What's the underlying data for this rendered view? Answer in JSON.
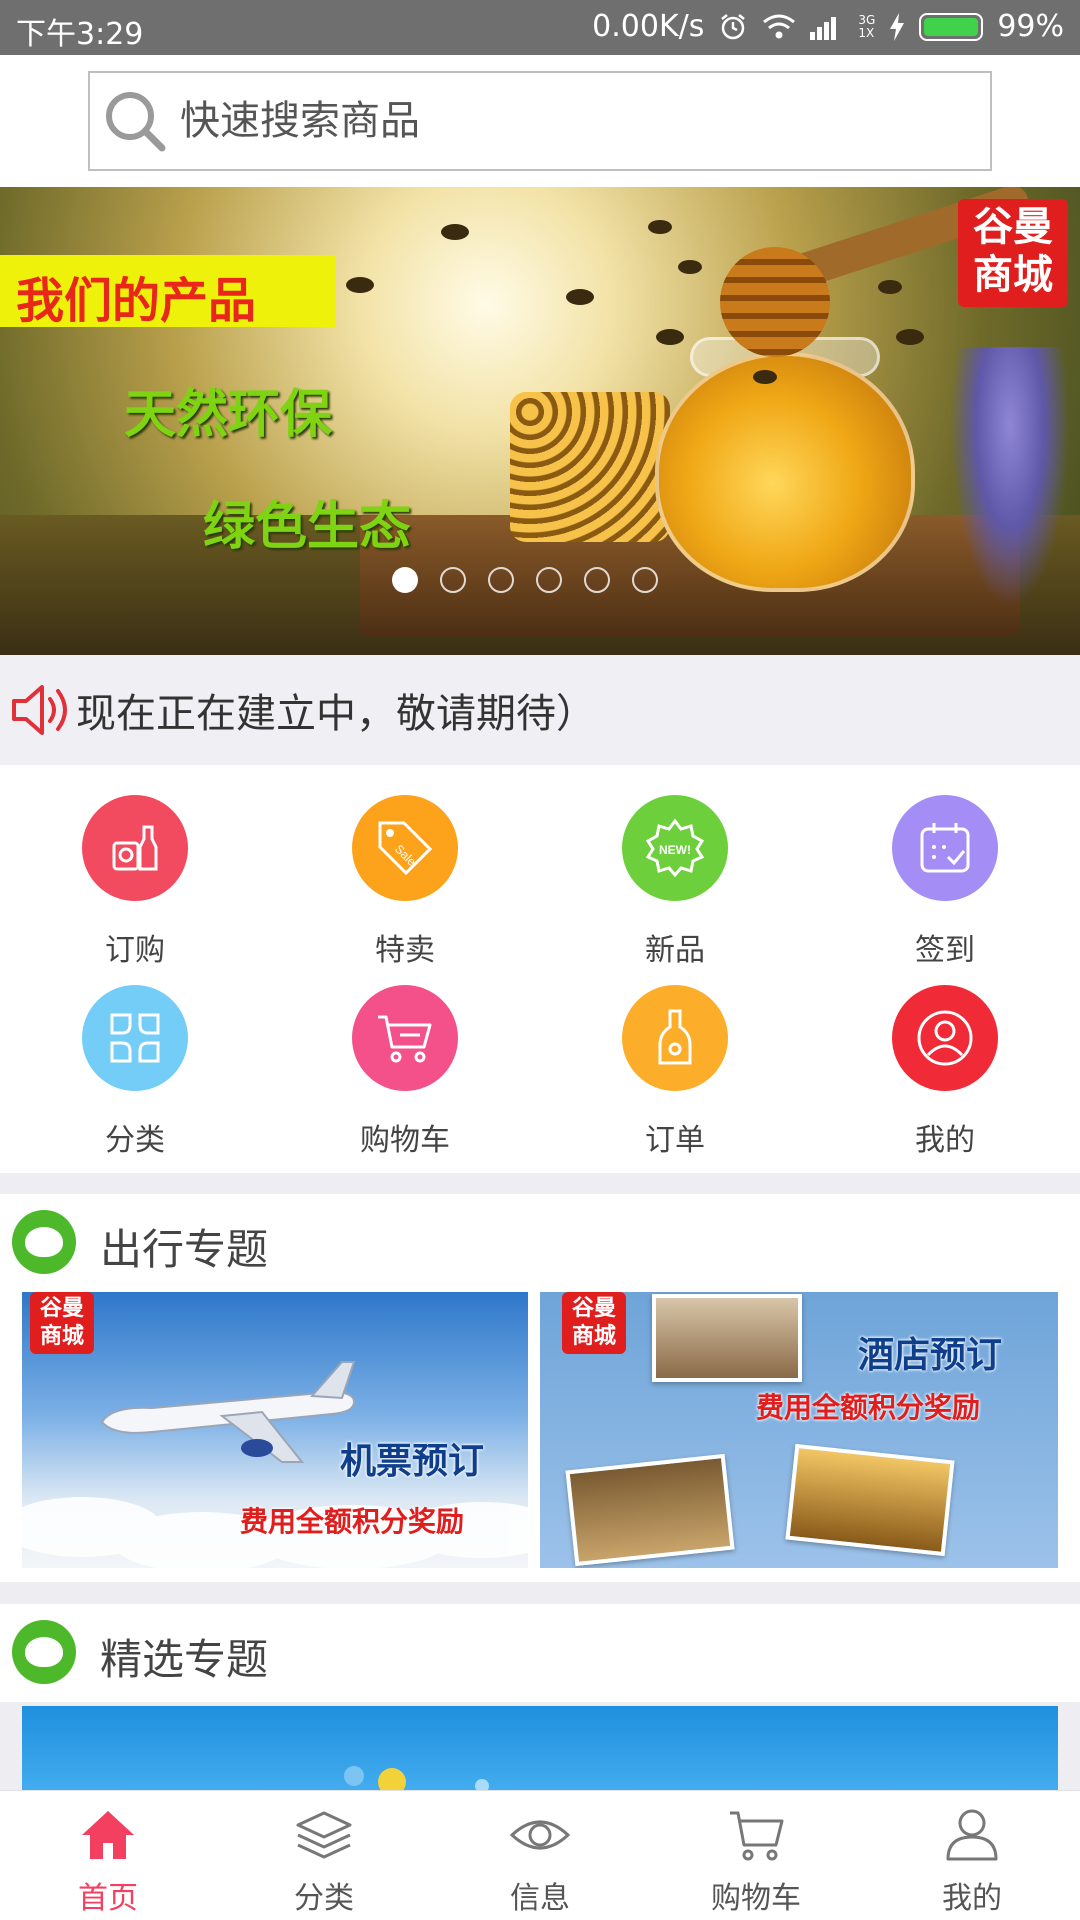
{
  "status_bar": {
    "time": "下午3:29",
    "network_speed": "0.00K/s",
    "network_type_top": "3G",
    "network_type_bottom": "1X",
    "battery": "99%"
  },
  "search": {
    "placeholder": "快速搜索商品"
  },
  "banner": {
    "brand_line1": "谷曼",
    "brand_line2": "商城",
    "title": "我们的产品",
    "line1": "天然环保",
    "line2": "绿色生态",
    "slide_count": 6,
    "active_slide": 1
  },
  "notice": {
    "text": "现在正在建立中，敬请期待）"
  },
  "grid": {
    "items": [
      {
        "label": "订购",
        "color": "#f24a5e",
        "icon": "bottle-icon"
      },
      {
        "label": "特卖",
        "color": "#fda21b",
        "icon": "sale-tag-icon"
      },
      {
        "label": "新品",
        "color": "#6dcf3c",
        "icon": "new-badge-icon"
      },
      {
        "label": "签到",
        "color": "#a48ef6",
        "icon": "calendar-check-icon"
      },
      {
        "label": "分类",
        "color": "#74cdf6",
        "icon": "category-icon"
      },
      {
        "label": "购物车",
        "color": "#f4508a",
        "icon": "cart-icon"
      },
      {
        "label": "订单",
        "color": "#fcae2a",
        "icon": "order-bottle-icon"
      },
      {
        "label": "我的",
        "color": "#f02a37",
        "icon": "user-icon"
      }
    ]
  },
  "sections": {
    "travel_title": "出行专题",
    "featured_title": "精选专题"
  },
  "promos": {
    "flight": {
      "brand_line1": "谷曼",
      "brand_line2": "商城",
      "title": "机票预订",
      "subtitle": "费用全额积分奖励"
    },
    "hotel": {
      "brand_line1": "谷曼",
      "brand_line2": "商城",
      "title": "酒店预订",
      "subtitle": "费用全额积分奖励"
    }
  },
  "bottom_nav": {
    "items": [
      {
        "label": "首页",
        "icon": "home-icon",
        "active": true
      },
      {
        "label": "分类",
        "icon": "layers-icon",
        "active": false
      },
      {
        "label": "信息",
        "icon": "eye-icon",
        "active": false
      },
      {
        "label": "购物车",
        "icon": "cart-icon",
        "active": false
      },
      {
        "label": "我的",
        "icon": "user-icon",
        "active": false
      }
    ]
  },
  "colors": {
    "accent": "#f44060",
    "brand_red": "#e01e1e",
    "section_logo_green": "#4cb82a"
  }
}
